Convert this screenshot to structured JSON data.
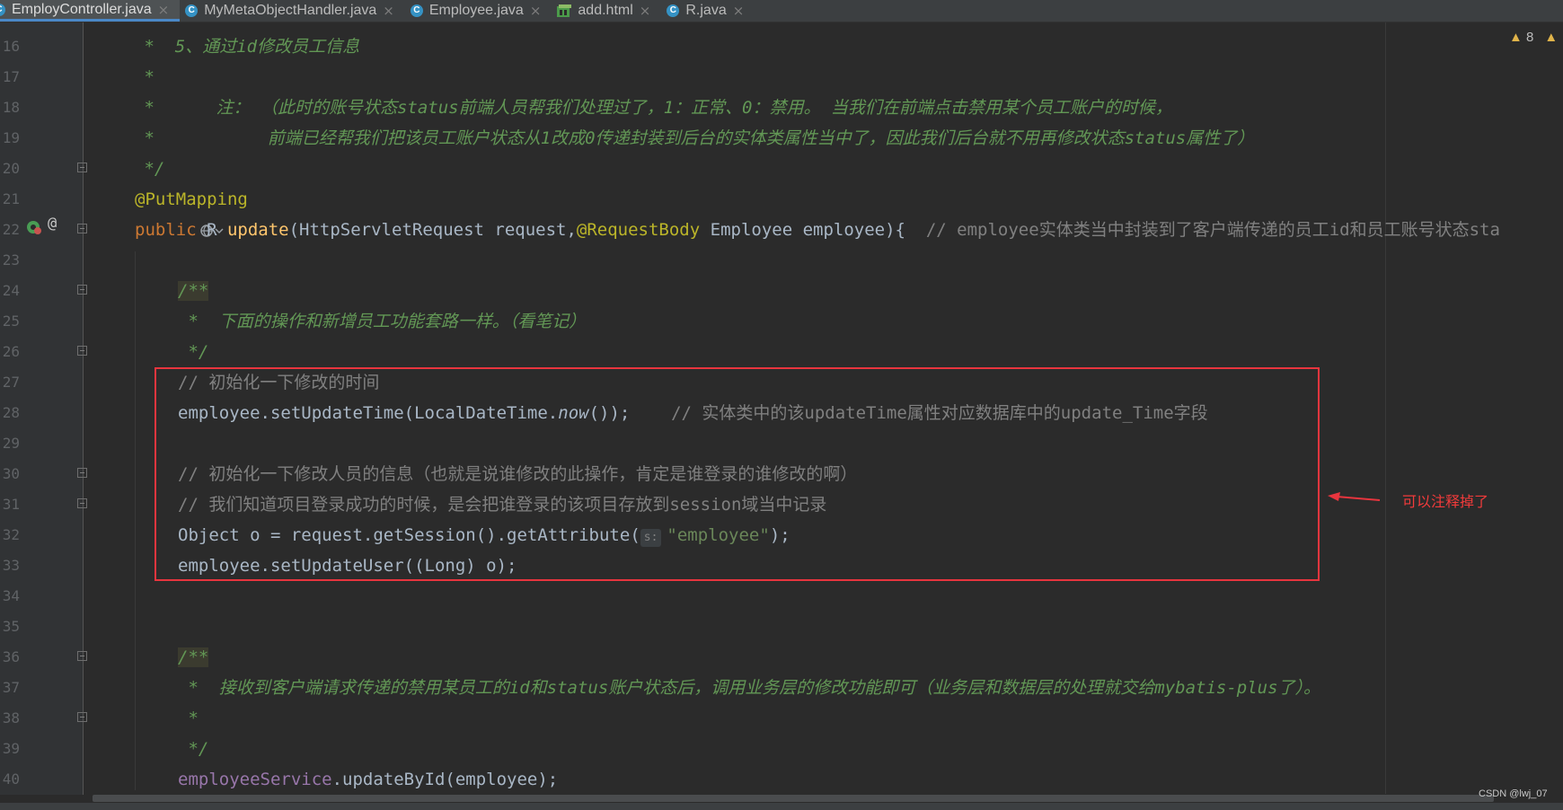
{
  "tabs": [
    {
      "label": "EmployController.java",
      "icon": "class-icon",
      "active": true
    },
    {
      "label": "MyMetaObjectHandler.java",
      "icon": "class-icon",
      "active": false
    },
    {
      "label": "Employee.java",
      "icon": "class-icon",
      "active": false
    },
    {
      "label": "add.html",
      "icon": "html-icon",
      "active": false
    },
    {
      "label": "R.java",
      "icon": "class-icon",
      "active": false
    }
  ],
  "tab_close_glyph": "×",
  "class_icon_letter": "C",
  "inspection": {
    "warnings": "8"
  },
  "line_numbers": [
    "16",
    "17",
    "18",
    "19",
    "20",
    "21",
    "22",
    "23",
    "24",
    "25",
    "26",
    "27",
    "28",
    "29",
    "30",
    "31",
    "32",
    "33",
    "34",
    "35",
    "36",
    "37",
    "38",
    "39",
    "40"
  ],
  "code": {
    "l16": {
      "star": " *  ",
      "text": "5、通过id修改员工信息"
    },
    "l17": {
      "star": " *"
    },
    "l18": {
      "star": " *      ",
      "text": "注： （此时的账号状态status前端人员帮我们处理过了，1：正常、0：禁用。 当我们在前端点击禁用某个员工账户的时候，"
    },
    "l19": {
      "star": " *",
      "text": "           前端已经帮我们把该员工账户状态从1改成0传递封装到后台的实体类属性当中了，因此我们后台就不用再修改状态status属性了）"
    },
    "l20": {
      "text": " */"
    },
    "l21": {
      "annotation": "@PutMapping"
    },
    "l22": {
      "kw_public": "public",
      "type_r": " R ",
      "method": "update",
      "params_a": "(HttpServletRequest request,",
      "ann_body": "@RequestBody",
      "params_b": " Employee employee){  ",
      "comment": "// employee实体类当中封装到了客户端传递的员工id和员工账号状态sta"
    },
    "l24": {
      "doc": "/**"
    },
    "l25": {
      "star": " *  ",
      "text": "下面的操作和新增员工功能套路一样。（看笔记）"
    },
    "l26": {
      "text": " */"
    },
    "l27": {
      "comment": "// 初始化一下修改的时间"
    },
    "l28": {
      "a": "employee.setUpdateTime(LocalDateTime.",
      "now": "now",
      "b": "());",
      "semi": "",
      "comment": "    // 实体类中的该updateTime属性对应数据库中的update_Time字段"
    },
    "l30": {
      "comment": "// 初始化一下修改人员的信息（也就是说谁修改的此操作，肯定是谁登录的谁修改的啊）"
    },
    "l31": {
      "comment": "// 我们知道项目登录成功的时候，是会把谁登录的该项目存放到session域当中记录"
    },
    "l32": {
      "a": "Object o = request.getSession().getAttribute(",
      "hint": "s:",
      "str": "\"employee\"",
      "b": ");"
    },
    "l33": {
      "a": "employee.setUpdateUser((Long) o);"
    },
    "l36": {
      "doc": "/**"
    },
    "l37": {
      "star": " *  ",
      "text": "接收到客户端请求传递的禁用某员工的id和status账户状态后，调用业务层的修改功能即可（业务层和数据层的处理就交给mybatis-plus了）。"
    },
    "l38": {
      "star": " *"
    },
    "l39": {
      "text": " */"
    },
    "l40": {
      "field": "employeeService",
      "rest": ".updateById(employee);"
    }
  },
  "annotation_note": "可以注释掉了",
  "watermark": "CSDN @lwj_07",
  "colors": {
    "editor_bg": "#2b2b2b",
    "keyword": "#cc7832",
    "annotation": "#bbb529",
    "method_decl": "#ffc66d",
    "string": "#6a8759",
    "doc_comment": "#629755",
    "line_comment": "#808080",
    "field": "#9876aa",
    "highlight_box": "#e8353e"
  }
}
